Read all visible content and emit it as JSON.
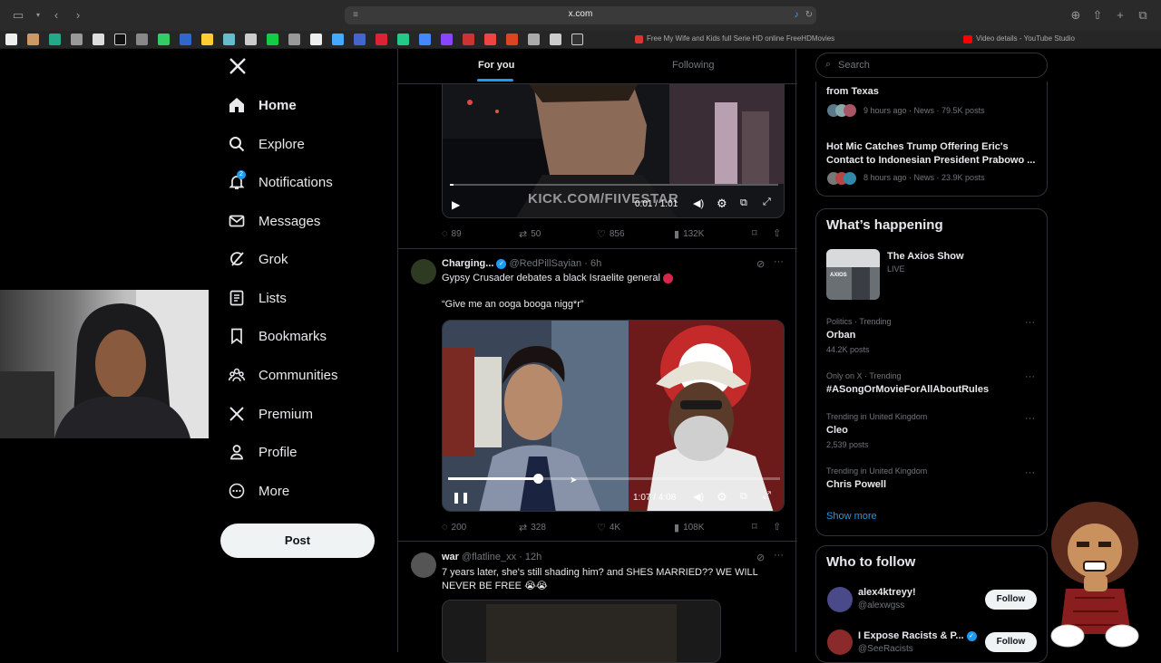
{
  "browser": {
    "url": "x.com",
    "tabs": [
      "Free My Wife and Kids full Serie HD online FreeHDMovies",
      "Video details - YouTube Studio"
    ]
  },
  "nav": {
    "items": [
      {
        "label": "Home",
        "icon": "home-icon"
      },
      {
        "label": "Explore",
        "icon": "search-icon"
      },
      {
        "label": "Notifications",
        "icon": "bell-icon",
        "badge": "2"
      },
      {
        "label": "Messages",
        "icon": "mail-icon"
      },
      {
        "label": "Grok",
        "icon": "grok-icon"
      },
      {
        "label": "Lists",
        "icon": "list-icon"
      },
      {
        "label": "Bookmarks",
        "icon": "bookmark-icon"
      },
      {
        "label": "Communities",
        "icon": "people-icon"
      },
      {
        "label": "Premium",
        "icon": "x-icon"
      },
      {
        "label": "Profile",
        "icon": "person-icon"
      },
      {
        "label": "More",
        "icon": "more-icon"
      }
    ],
    "post_label": "Post"
  },
  "timeline": {
    "tabs": {
      "for_you": "For you",
      "following": "Following"
    },
    "tweet1": {
      "watermark": "KICK.COM/FIIVESTAR",
      "time": "0:01 / 1:01",
      "replies": "89",
      "reposts": "50",
      "likes": "856",
      "views": "132K",
      "progress": 0.01
    },
    "tweet2": {
      "name": "Charging...",
      "handle": "@RedPillSayian",
      "time": "6h",
      "text": "Gypsy Crusader debates a black Israelite general",
      "quote": "“Give me an ooga booga nigg*r”",
      "video_time": "1:07 / 4:08",
      "progress": 0.27,
      "replies": "200",
      "reposts": "328",
      "likes": "4K",
      "views": "108K"
    },
    "tweet3": {
      "name": "war",
      "handle": "@flatline_xx",
      "time": "12h",
      "text": "7 years later, she's still shading him? and SHES MARRIED?? WE WILL NEVER BE FREE 😭😭"
    }
  },
  "search": {
    "placeholder": "Search"
  },
  "news": [
    {
      "title": "from Texas",
      "meta": "9 hours ago · News · 79.5K posts"
    },
    {
      "title": "Hot Mic Catches Trump Offering Eric's Contact to Indonesian President Prabowo ...",
      "meta": "8 hours ago · News · 23.9K posts"
    }
  ],
  "happening": {
    "heading": "What’s happening",
    "live": {
      "title": "The Axios Show",
      "status": "LIVE"
    },
    "trends": [
      {
        "category": "Politics · Trending",
        "name": "Orban",
        "count": "44.2K posts"
      },
      {
        "category": "Only on X · Trending",
        "name": "#ASongOrMovieForAllAboutRules",
        "count": ""
      },
      {
        "category": "Trending in United Kingdom",
        "name": "Cleo",
        "count": "2,539 posts"
      },
      {
        "category": "Trending in United Kingdom",
        "name": "Chris Powell",
        "count": ""
      }
    ],
    "show_more": "Show more"
  },
  "who_to_follow": {
    "heading": "Who to follow",
    "users": [
      {
        "name": "alex4ktreyy!",
        "handle": "@alexwgss",
        "button": "Follow"
      },
      {
        "name": "I Expose Racists & P...",
        "handle": "@SeeRacists",
        "button": "Follow"
      }
    ]
  },
  "colors": {
    "accent": "#1d9bf0",
    "background": "#000000",
    "text": "#e7e9ea",
    "muted": "#71767b"
  }
}
